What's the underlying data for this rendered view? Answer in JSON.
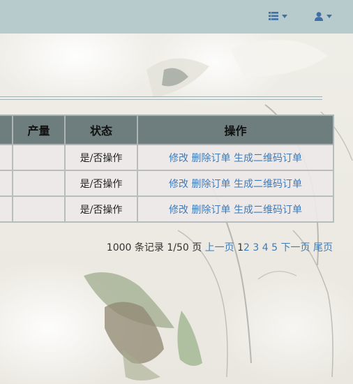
{
  "navbar": {
    "menu_icon": "list-icon",
    "user_icon": "user-icon",
    "caret_icon": "caret-down-icon",
    "bg_color": "#b7cacc",
    "icon_color": "#3f6fa6"
  },
  "table": {
    "columns": [
      "产量",
      "状态",
      "操作"
    ],
    "rows": [
      {
        "output": "",
        "status": "是/否操作",
        "edit": "修改",
        "delete": "删除订单",
        "qr": "生成二维码订单"
      },
      {
        "output": "",
        "status": "是/否操作",
        "edit": "修改",
        "delete": "删除订单",
        "qr": "生成二维码订单"
      },
      {
        "output": "",
        "status": "是/否操作",
        "edit": "修改",
        "delete": "删除订单",
        "qr": "生成二维码订单"
      }
    ],
    "header_color": "#6e7d7d",
    "link_color": "#3f7bb8"
  },
  "pagination": {
    "summary": "1000 条记录 1/50 页",
    "prev": "上一页",
    "current": "1",
    "pages": [
      "2",
      "3",
      "4",
      "5"
    ],
    "next": "下一页",
    "last": "尾页"
  }
}
